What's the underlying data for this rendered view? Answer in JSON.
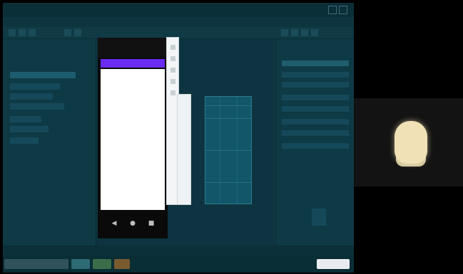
{
  "window": {
    "title": "",
    "menu_items": [
      "",
      "",
      "",
      "",
      "",
      ""
    ]
  },
  "emulator": {
    "app_title": "",
    "content_text": ""
  },
  "statusbar": {
    "text": ""
  },
  "video": {
    "participant_label": ""
  },
  "colors": {
    "app_background": "#0e3b47",
    "emulator_appbar": "#6a2cf3",
    "taskbar_right": "#e9ecef"
  }
}
